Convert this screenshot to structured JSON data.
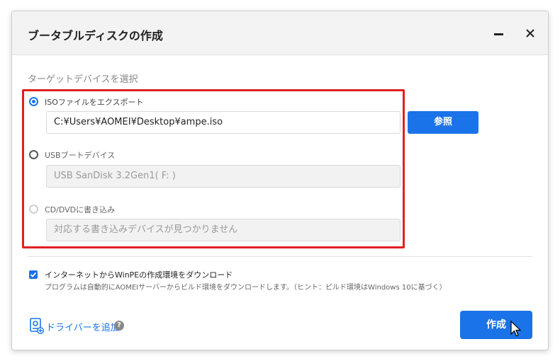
{
  "window": {
    "title": "ブータブルディスクの作成"
  },
  "target": {
    "section_label": "ターゲットデバイスを選択",
    "options": [
      {
        "label": "ISOファイルをエクスポート",
        "value": "C:¥Users¥AOMEI¥Desktop¥ampe.iso",
        "state": "selected"
      },
      {
        "label": "USBブートデバイス",
        "value": "USB SanDisk 3.2Gen1( F: )",
        "state": "unselected"
      },
      {
        "label": "CD/DVDに書き込み",
        "value": "対応する書き込みデバイスが見つかりません",
        "state": "disabled"
      }
    ],
    "browse_label": "参照"
  },
  "download": {
    "checked": true,
    "label": "インターネットからWinPEの作成環境をダウンロード",
    "note": "プログラムは自動的にAOMEIサーバーからビルド環境をダウンロードします。（ヒント：ビルド環境はWindows 10に基づく）"
  },
  "footer": {
    "driver_label": "ドライバーを追加",
    "help_glyph": "?",
    "create_label": "作成"
  },
  "colors": {
    "accent": "#1a73e8",
    "highlight_border": "#e02020"
  }
}
